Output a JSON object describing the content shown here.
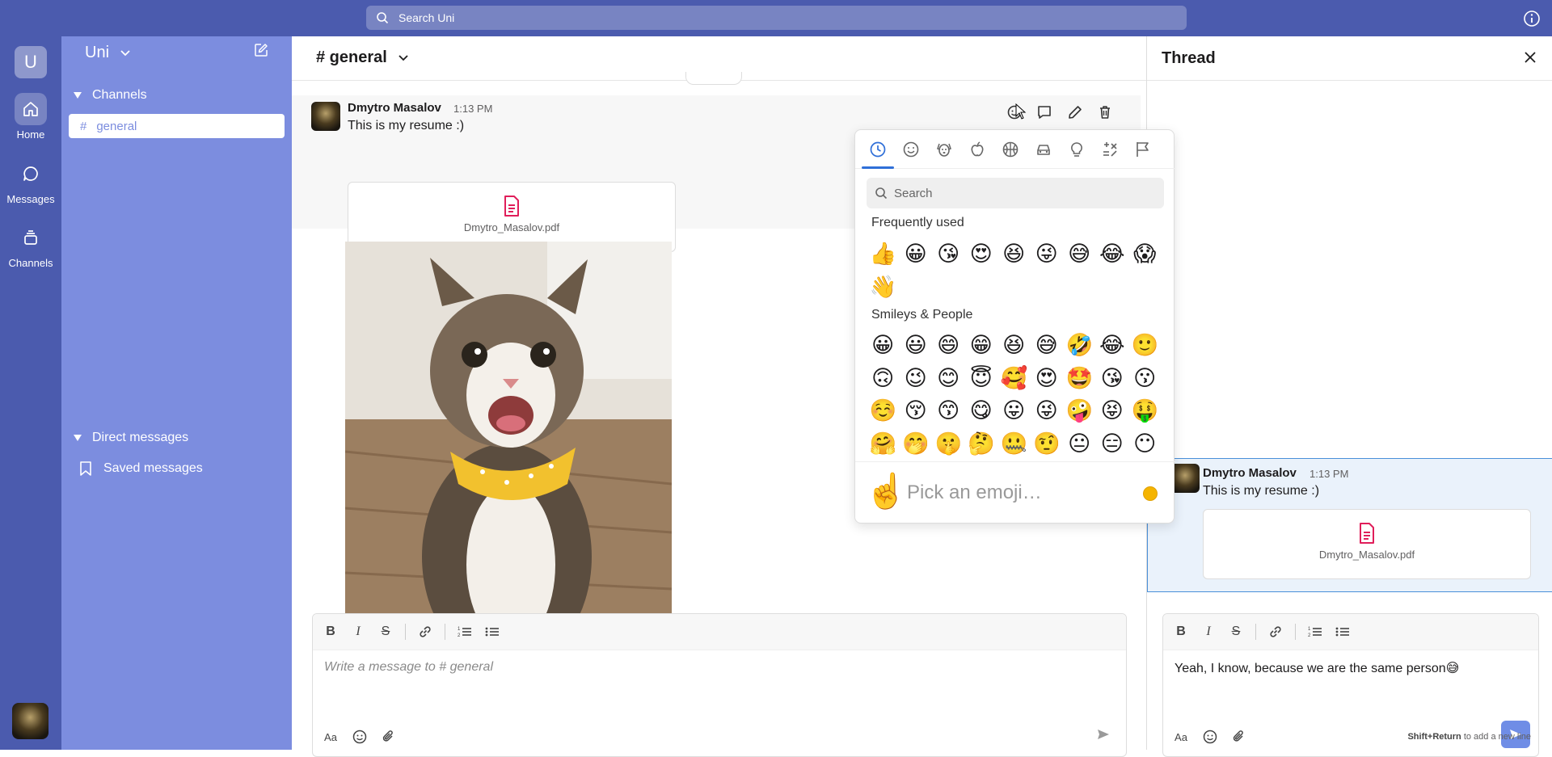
{
  "topbar": {
    "search_placeholder": "Search Uni"
  },
  "rail": {
    "workspace_initial": "U",
    "items": [
      {
        "label": "Home",
        "icon": "home-icon"
      },
      {
        "label": "Messages",
        "icon": "message-icon"
      },
      {
        "label": "Channels",
        "icon": "channels-icon"
      }
    ]
  },
  "sidebar": {
    "workspace_name": "Uni",
    "channels_header": "Channels",
    "channels": [
      {
        "hash": "#",
        "name": "general"
      }
    ],
    "dm_header": "Direct messages",
    "saved_label": "Saved messages"
  },
  "channel": {
    "title": "# general"
  },
  "message": {
    "author": "Dmytro Masalov",
    "time": "1:13 PM",
    "text": "This is my resume :)",
    "file_name": "Dmytro_Masalov.pdf"
  },
  "composer": {
    "placeholder": "Write a message to # general"
  },
  "thread": {
    "title": "Thread",
    "parent": {
      "author": "Dmytro Masalov",
      "time": "1:13 PM",
      "text": "This is my resume :)",
      "file_name": "Dmytro_Masalov.pdf"
    },
    "draft": "Yeah, I know, because we are the same person😅",
    "hint_key": "Shift+Return",
    "hint_text": " to add a new line"
  },
  "emoji_picker": {
    "search_placeholder": "Search",
    "frequent_label": "Frequently used",
    "frequent": [
      "👍",
      "😀",
      "😘",
      "😍",
      "😆",
      "😜",
      "😅",
      "😂",
      "😱",
      "👋"
    ],
    "smileys_label": "Smileys & People",
    "smileys": [
      "😀",
      "😃",
      "😄",
      "😁",
      "😆",
      "😅",
      "🤣",
      "😂",
      "🙂",
      "🙃",
      "😉",
      "😊",
      "😇",
      "🥰",
      "😍",
      "🤩",
      "😘",
      "😗",
      "☺️",
      "😚",
      "😙",
      "😋",
      "😛",
      "😜",
      "🤪",
      "😝",
      "🤑",
      "🤗",
      "🤭",
      "🤫",
      "🤔",
      "🤐",
      "🤨",
      "😐",
      "😑",
      "😶"
    ],
    "preview_emoji": "☝️",
    "footer_hint": "Pick an emoji…",
    "skin_color": "#f5b400"
  },
  "colors": {
    "brand": "#4b5bae",
    "sidebar": "#7c8ddf",
    "accent": "#2f6fd8",
    "file_icon": "#e01e5a"
  }
}
